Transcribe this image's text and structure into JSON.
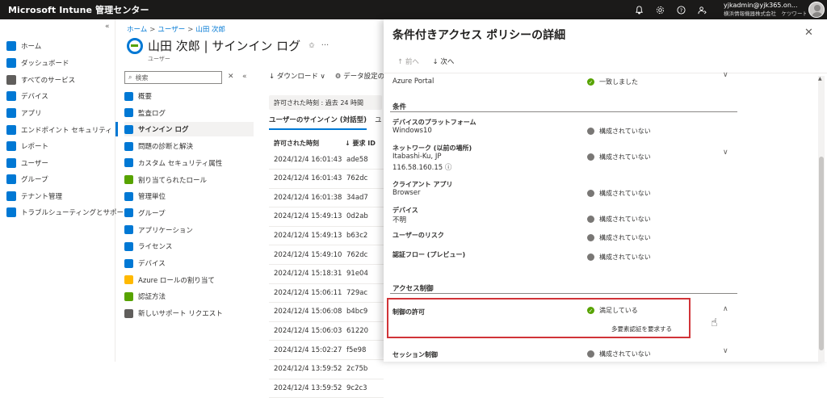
{
  "topbar": {
    "app_title": "Microsoft Intune 管理センター",
    "account_name": "yjkadmin@yjk365.on...",
    "account_org": "横浜情報機器株式会社　ケツワート..."
  },
  "leftnav": {
    "collapse": "«",
    "items": [
      {
        "label": "ホーム",
        "icon": "home-icon",
        "color": "#0078d4"
      },
      {
        "label": "ダッシュボード",
        "icon": "dashboard-icon",
        "color": "#0078d4"
      },
      {
        "label": "すべてのサービス",
        "icon": "list-icon",
        "color": "#605e5c"
      },
      {
        "label": "デバイス",
        "icon": "device-icon",
        "color": "#0078d4"
      },
      {
        "label": "アプリ",
        "icon": "apps-icon",
        "color": "#0078d4"
      },
      {
        "label": "エンドポイント セキュリティ",
        "icon": "shield-icon",
        "color": "#0078d4"
      },
      {
        "label": "レポート",
        "icon": "report-icon",
        "color": "#0078d4"
      },
      {
        "label": "ユーザー",
        "icon": "user-icon",
        "color": "#0078d4"
      },
      {
        "label": "グループ",
        "icon": "group-icon",
        "color": "#0078d4"
      },
      {
        "label": "テナント管理",
        "icon": "tenant-icon",
        "color": "#0078d4"
      },
      {
        "label": "トラブルシューティングとサポート",
        "icon": "wrench-icon",
        "color": "#0078d4"
      }
    ]
  },
  "breadcrumb": {
    "items": [
      "ホーム",
      "ユーザー",
      "山田 次郎"
    ],
    "sep": ">"
  },
  "blade": {
    "title": "山田 次郎 | サインイン ログ",
    "subtitle": "ユーザー",
    "pin": "✩",
    "more": "···",
    "search_placeholder": "検索",
    "search_icon_glyph": "⌕",
    "x_glyph": "✕",
    "collapse_glyph": "«",
    "menu": [
      {
        "label": "概要",
        "color": "#0078d4"
      },
      {
        "label": "監査ログ",
        "color": "#0078d4"
      },
      {
        "label": "サインイン ログ",
        "color": "#0078d4",
        "active": true
      },
      {
        "label": "問題の診断と解決",
        "color": "#0078d4"
      },
      {
        "label": "カスタム セキュリティ属性",
        "color": "#0078d4"
      },
      {
        "label": "割り当てられたロール",
        "color": "#57a300"
      },
      {
        "label": "管理単位",
        "color": "#0078d4"
      },
      {
        "label": "グループ",
        "color": "#0078d4"
      },
      {
        "label": "アプリケーション",
        "color": "#0078d4"
      },
      {
        "label": "ライセンス",
        "color": "#0078d4"
      },
      {
        "label": "デバイス",
        "color": "#0078d4"
      },
      {
        "label": "Azure ロールの割り当て",
        "color": "#ffb900"
      },
      {
        "label": "認証方法",
        "color": "#57a300"
      },
      {
        "label": "新しいサポート リクエスト",
        "color": "#605e5c"
      }
    ]
  },
  "toolbar": {
    "download": "↓ ダウンロード ∨",
    "settings": "⚙ データ設定のエ"
  },
  "filter": {
    "time": "許可された時刻 : 過去 24 時間"
  },
  "tabs": {
    "interactive": "ユーザーのサインイン (対話型)",
    "other": "ユ"
  },
  "table": {
    "headers": [
      "許可された時刻",
      "↓ 要求 ID"
    ],
    "rows": [
      {
        "date": "2024/12/4 16:01:43",
        "id": "ade58"
      },
      {
        "date": "2024/12/4 16:01:43",
        "id": "762dc"
      },
      {
        "date": "2024/12/4 16:01:38",
        "id": "34ad7"
      },
      {
        "date": "2024/12/4 15:49:13",
        "id": "0d2ab"
      },
      {
        "date": "2024/12/4 15:49:13",
        "id": "b63c2"
      },
      {
        "date": "2024/12/4 15:49:10",
        "id": "762dc"
      },
      {
        "date": "2024/12/4 15:18:31",
        "id": "91e04"
      },
      {
        "date": "2024/12/4 15:06:11",
        "id": "729ac"
      },
      {
        "date": "2024/12/4 15:06:08",
        "id": "b4bc9"
      },
      {
        "date": "2024/12/4 15:06:03",
        "id": "61220"
      },
      {
        "date": "2024/12/4 15:02:27",
        "id": "f5e98"
      },
      {
        "date": "2024/12/4 13:59:52",
        "id": "2c75b"
      },
      {
        "date": "2024/12/4 13:59:52",
        "id": "9c2c3"
      }
    ]
  },
  "panel": {
    "title": "条件付きアクセス ポリシーの詳細",
    "close": "✕",
    "prev": "↑ 前へ",
    "next": "↓ 次へ",
    "app_value": "Azure Portal",
    "app_status": "一致しました",
    "conditions_header": "条件",
    "conditions": [
      {
        "label": "デバイスのプラットフォーム",
        "value": "Windows10",
        "status": "構成されていない"
      },
      {
        "label": "ネットワーク (以前の場所)",
        "value": "Itabashi-Ku, JP",
        "value2": "116.58.160.15 ⓘ",
        "status": "構成されていない"
      },
      {
        "label": "クライアント アプリ",
        "value": "Browser",
        "status": "構成されていない"
      },
      {
        "label": "デバイス",
        "value": "不明",
        "status": "構成されていない"
      },
      {
        "label": "ユーザーのリスク",
        "value": "",
        "status": "構成されていない"
      },
      {
        "label": "認証フロー (プレビュー)",
        "value": "",
        "status": "構成されていない"
      }
    ],
    "access_header": "アクセス制御",
    "grant_label": "制御の許可",
    "grant_status": "満足している",
    "grant_detail": "多要素認証を要求する",
    "session_label": "セッション制御",
    "session_status": "構成されていない",
    "check_glyph": "✓",
    "chev_down": "∨",
    "chev_up": "∧"
  },
  "colors": {
    "accent": "#0078d4",
    "ok": "#57a300",
    "highlight": "#d13438"
  }
}
